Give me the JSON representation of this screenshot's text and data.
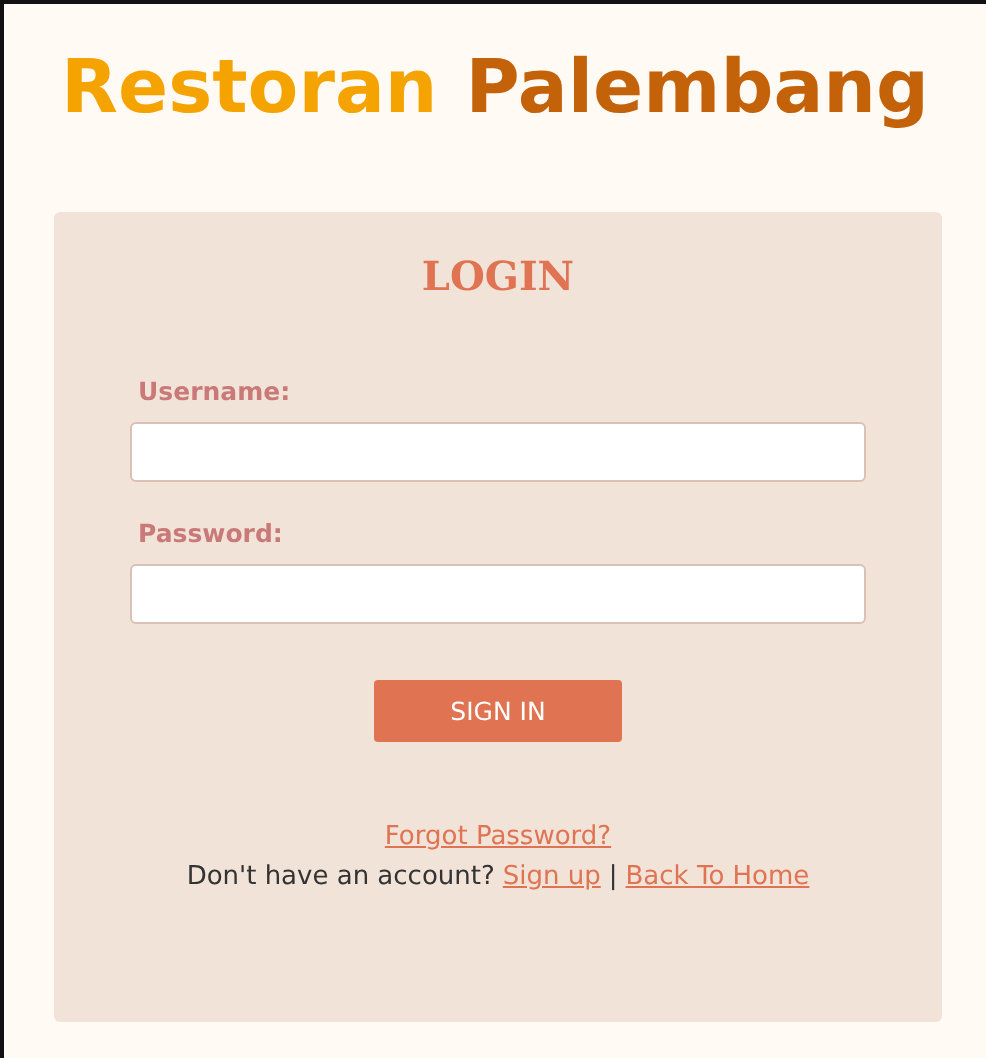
{
  "brand": {
    "first": "Restoran",
    "second": "Palembang"
  },
  "login": {
    "heading": "LOGIN",
    "fields": [
      {
        "label": "Username:"
      },
      {
        "label": "Password:"
      }
    ],
    "button": "SIGN IN",
    "forgot_link": "Forgot Password?",
    "signup_prompt": "Don't have an account?",
    "signup_link": "Sign up",
    "separator": "|",
    "home_link": "Back To Home"
  }
}
